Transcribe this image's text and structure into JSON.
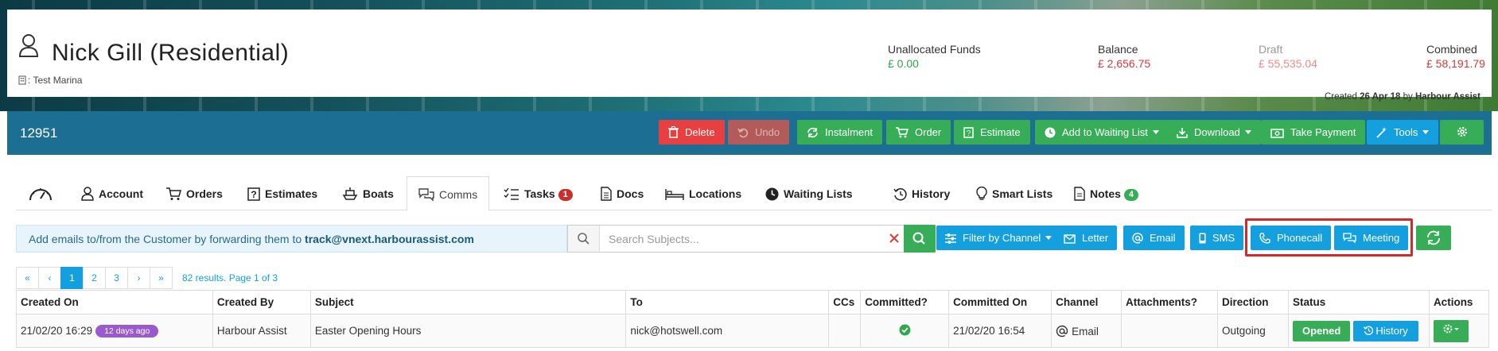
{
  "customer": {
    "name": "Nick Gill (Residential)",
    "site": ": Test Marina"
  },
  "funds": [
    {
      "label": "Unallocated Funds",
      "value": "£ 0.00",
      "color": "#2ea84a"
    },
    {
      "label": "Balance",
      "value": "£ 2,656.75",
      "color": "#d43a3a"
    },
    {
      "label": "Draft",
      "value": "£ 55,535.04",
      "color": "#f08a8a"
    },
    {
      "label": "Combined",
      "value": "£ 58,191.79",
      "color": "#d43a3a"
    }
  ],
  "created": {
    "prefix": "Created",
    "date": "26 Apr 18",
    "by": "by",
    "author": "Harbour Assist"
  },
  "account_number": "12951",
  "toolbar": {
    "delete": "Delete",
    "undo": "Undo",
    "instalment": "Instalment",
    "order": "Order",
    "estimate": "Estimate",
    "waiting_list": "Add to Waiting List",
    "download": "Download",
    "take_payment": "Take Payment",
    "tools": "Tools"
  },
  "tabs": {
    "account": "Account",
    "orders": "Orders",
    "estimates": "Estimates",
    "boats": "Boats",
    "comms": "Comms",
    "tasks": "Tasks",
    "tasks_count": "1",
    "docs": "Docs",
    "locations": "Locations",
    "waiting_lists": "Waiting Lists",
    "history": "History",
    "smart_lists": "Smart Lists",
    "notes": "Notes",
    "notes_count": "4"
  },
  "info": {
    "text": "Add emails to/from the Customer by forwarding them to",
    "email": "track@vnext.harbourassist.com"
  },
  "search": {
    "placeholder": "Search Subjects..."
  },
  "actions": {
    "filter": "Filter by Channel",
    "letter": "Letter",
    "email": "Email",
    "sms": "SMS",
    "phonecall": "Phonecall",
    "meeting": "Meeting"
  },
  "pager": {
    "first": "«",
    "prev": "‹",
    "p1": "1",
    "p2": "2",
    "p3": "3",
    "next": "›",
    "last": "»",
    "info": "82 results. Page 1 of 3"
  },
  "table": {
    "headers": [
      "Created On",
      "Created By",
      "Subject",
      "To",
      "CCs",
      "Committed?",
      "Committed On",
      "Channel",
      "Attachments?",
      "Direction",
      "Status",
      "Actions"
    ],
    "row": {
      "created_on": "21/02/20 16:29",
      "age": "12 days ago",
      "created_by": "Harbour Assist",
      "subject": "Easter Opening Hours",
      "to": "nick@hotswell.com",
      "committed_on": "21/02/20 16:54",
      "channel": "Email",
      "direction": "Outgoing",
      "status": "Opened",
      "history": "History"
    }
  },
  "colors": {
    "primary": "#14a0df",
    "success": "#36ad56",
    "danger": "#e84040",
    "toolbar": "#1c6e93"
  }
}
